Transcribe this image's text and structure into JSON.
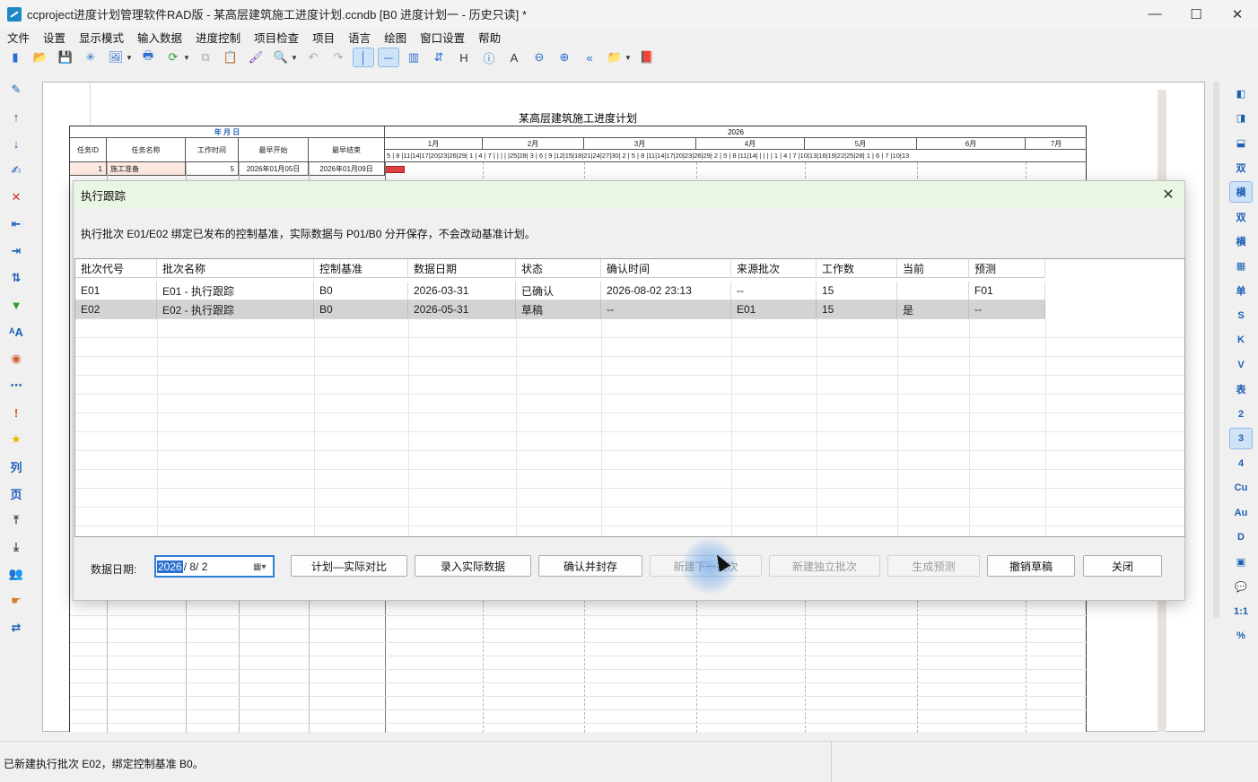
{
  "window": {
    "title": "ccproject进度计划管理软件RAD版 - 某高层建筑施工进度计划.ccndb [B0 进度计划一 - 历史只读] *",
    "minimize": "—",
    "maximize": "☐",
    "close": "✕"
  },
  "menu": [
    "文件",
    "设置",
    "显示模式",
    "输入数据",
    "进度控制",
    "项目检查",
    "项目",
    "语言",
    "绘图",
    "窗口设置",
    "帮助"
  ],
  "toolbar_icons": [
    "new-doc-icon",
    "open-folder-icon",
    "save-icon",
    "asterisk-icon",
    "export-image-icon",
    "print-icon",
    "refresh-icon",
    "copy-icon",
    "paste-icon",
    "format-brush-icon",
    "search-icon",
    "undo-icon",
    "redo-icon",
    "vertical-line-icon",
    "horizontal-line-icon",
    "columns-icon",
    "sort-icon",
    "header-icon",
    "info-icon",
    "text-icon",
    "zoom-out-icon",
    "zoom-in-icon",
    "rewind-icon",
    "folder-icon",
    "red-folder-icon"
  ],
  "left_tools": {
    "items": [
      {
        "icon": "pencil-icon",
        "glyph": "✎",
        "color": "#1a5fb4"
      },
      {
        "icon": "arrow-up-icon",
        "glyph": "↑",
        "color": "#444"
      },
      {
        "icon": "arrow-down-icon",
        "glyph": "↓",
        "color": "#1a5fb4"
      },
      {
        "icon": "edit-icon",
        "glyph": "✍",
        "color": "#1a5fb4"
      },
      {
        "icon": "delete-icon",
        "glyph": "✕",
        "color": "#d03030"
      },
      {
        "icon": "outdent-icon",
        "glyph": "⇤",
        "color": "#1a5fb4"
      },
      {
        "icon": "indent-icon",
        "glyph": "⇥",
        "color": "#1a5fb4"
      },
      {
        "icon": "swap-vertical-icon",
        "glyph": "⇅",
        "color": "#1a5fb4"
      },
      {
        "icon": "filter-icon",
        "glyph": "▼",
        "color": "#2a9a2a"
      },
      {
        "icon": "font-size-icon",
        "glyph": "ᴬA",
        "color": "#1a5fb4"
      },
      {
        "icon": "palette-icon",
        "glyph": "◉",
        "color": "#d06030"
      },
      {
        "icon": "dots-icon",
        "glyph": "⋯",
        "color": "#1a5fb4"
      },
      {
        "icon": "exclamation-icon",
        "glyph": "!",
        "color": "#e05020"
      },
      {
        "icon": "star-icon",
        "glyph": "★",
        "color": "#e6b800"
      },
      {
        "icon": "column-icon",
        "glyph": "列",
        "color": "#1a5fb4"
      },
      {
        "icon": "page-icon",
        "glyph": "页",
        "color": "#1a5fb4"
      },
      {
        "icon": "move-top-icon",
        "glyph": "⤒",
        "color": "#444"
      },
      {
        "icon": "move-bottom-icon",
        "glyph": "⤓",
        "color": "#444"
      },
      {
        "icon": "users-icon",
        "glyph": "👥",
        "color": "#2a9a2a"
      },
      {
        "icon": "hand-icon",
        "glyph": "☛",
        "color": "#d08030"
      },
      {
        "icon": "exchange-icon",
        "glyph": "⇄",
        "color": "#1a5fb4"
      }
    ]
  },
  "right_tools": {
    "items": [
      {
        "icon": "layout-left-icon",
        "glyph": "◧",
        "active": false
      },
      {
        "icon": "layout-right-icon",
        "glyph": "◨",
        "active": false
      },
      {
        "icon": "layout-bottom-icon",
        "glyph": "⬓",
        "active": false
      },
      {
        "icon": "double-icon",
        "glyph": "双",
        "active": false
      },
      {
        "icon": "horizontal-icon",
        "glyph": "横",
        "active": true
      },
      {
        "icon": "double-gear-icon",
        "glyph": "双",
        "active": false
      },
      {
        "icon": "horizontal-gear-icon",
        "glyph": "横",
        "active": false
      },
      {
        "icon": "table-icon",
        "glyph": "▦",
        "active": false
      },
      {
        "icon": "single-icon",
        "glyph": "单",
        "active": false
      },
      {
        "icon": "s-icon",
        "glyph": "S",
        "active": false
      },
      {
        "icon": "k-icon",
        "glyph": "K",
        "active": false
      },
      {
        "icon": "v-icon",
        "glyph": "V",
        "active": false
      },
      {
        "icon": "table-text-icon",
        "glyph": "表",
        "active": false
      },
      {
        "icon": "level-2-icon",
        "glyph": "2",
        "active": false
      },
      {
        "icon": "level-3-icon",
        "glyph": "3",
        "active": true
      },
      {
        "icon": "level-4-icon",
        "glyph": "4",
        "active": false
      },
      {
        "icon": "cu-icon",
        "glyph": "Cu",
        "active": false
      },
      {
        "icon": "au-icon",
        "glyph": "Au",
        "active": false
      },
      {
        "icon": "d-icon",
        "glyph": "D",
        "active": false
      },
      {
        "icon": "calc-icon",
        "glyph": "▣",
        "active": false
      },
      {
        "icon": "comment-icon",
        "glyph": "💬",
        "active": false
      },
      {
        "icon": "ratio-icon",
        "glyph": "1:1",
        "active": false
      },
      {
        "icon": "percent-icon",
        "glyph": "%",
        "active": false
      }
    ]
  },
  "gantt": {
    "title": "某高层建筑施工进度计划",
    "year": "2026",
    "year_month_label": "年 月 日",
    "columns": [
      "任务ID",
      "任务名称",
      "工作时间",
      "最早开始",
      "最早结束"
    ],
    "months": [
      "1月",
      "2月",
      "3月",
      "4月",
      "5月",
      "6月",
      "7月"
    ],
    "days": "5 | 8 |11|14|17|20|23|26|29| 1 | 4 | 7 |  |  |  |  |25|28| 3 | 6 | 9 |12|15|18|21|24|27|30| 2 | 5 | 8 |11|14|17|20|23|26|29| 2 | 5 | 8 |11|14|  |  |  |  | 1 | 4 | 7 |10|13|16|19|22|25|28| 1 | 6 | 7 |10|13",
    "row1": {
      "id": "1",
      "name": "施工准备",
      "duration": "5",
      "start": "2026年01月05日",
      "end": "2026年01月09日"
    }
  },
  "dialog": {
    "title": "执行跟踪",
    "description": "执行批次 E01/E02 绑定已发布的控制基准，实际数据与 P01/B0 分开保存，不会改动基准计划。",
    "columns": [
      "批次代号",
      "批次名称",
      "控制基准",
      "数据日期",
      "状态",
      "确认时间",
      "来源批次",
      "工作数",
      "当前",
      "预测"
    ],
    "rows": [
      {
        "code": "E01",
        "name": "E01 - 执行跟踪",
        "baseline": "B0",
        "date": "2026-03-31",
        "status": "已确认",
        "confirmed": "2026-08-02 23:13",
        "source": "--",
        "count": "15",
        "current": "",
        "forecast": "F01"
      },
      {
        "code": "E02",
        "name": "E02 - 执行跟踪",
        "baseline": "B0",
        "date": "2026-05-31",
        "status": "草稿",
        "confirmed": "--",
        "source": "E01",
        "count": "15",
        "current": "是",
        "forecast": "--"
      }
    ],
    "data_date_label": "数据日期:",
    "data_date_year": "2026",
    "data_date_rest": "/  8/  2",
    "buttons": {
      "compare": "计划—实际对比",
      "enter_actual": "录入实际数据",
      "confirm_seal": "确认并封存",
      "new_next": "新建下一批次",
      "new_independent": "新建独立批次",
      "forecast": "生成预测",
      "revoke_draft": "撤销草稿",
      "close": "关闭"
    }
  },
  "status": {
    "message": "已新建执行批次 E02，绑定控制基准 B0。"
  }
}
